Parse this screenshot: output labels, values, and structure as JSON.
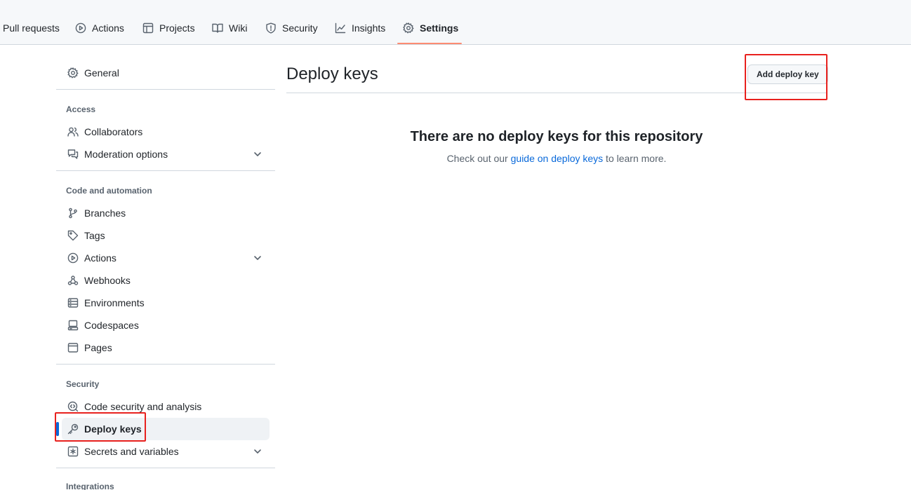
{
  "topnav": {
    "tabs": [
      {
        "label": "Pull requests",
        "icon": "pull-request-icon"
      },
      {
        "label": "Actions",
        "icon": "play-icon"
      },
      {
        "label": "Projects",
        "icon": "table-icon"
      },
      {
        "label": "Wiki",
        "icon": "book-icon"
      },
      {
        "label": "Security",
        "icon": "shield-icon"
      },
      {
        "label": "Insights",
        "icon": "graph-icon"
      },
      {
        "label": "Settings",
        "icon": "gear-icon",
        "active": true
      }
    ]
  },
  "sidebar": {
    "general": "General",
    "access_heading": "Access",
    "collaborators": "Collaborators",
    "moderation": "Moderation options",
    "code_heading": "Code and automation",
    "branches": "Branches",
    "tags": "Tags",
    "actions": "Actions",
    "webhooks": "Webhooks",
    "environments": "Environments",
    "codespaces": "Codespaces",
    "pages": "Pages",
    "security_heading": "Security",
    "code_security": "Code security and analysis",
    "deploy_keys": "Deploy keys",
    "secrets": "Secrets and variables",
    "integrations_heading": "Integrations"
  },
  "main": {
    "title": "Deploy keys",
    "add_button": "Add deploy key",
    "blank_title": "There are no deploy keys for this repository",
    "blank_prefix": "Check out our ",
    "blank_link": "guide on deploy keys",
    "blank_suffix": " to learn more."
  },
  "colors": {
    "accent": "#0969da",
    "tab_underline": "#fd8c73",
    "highlight": "#e8211e"
  }
}
